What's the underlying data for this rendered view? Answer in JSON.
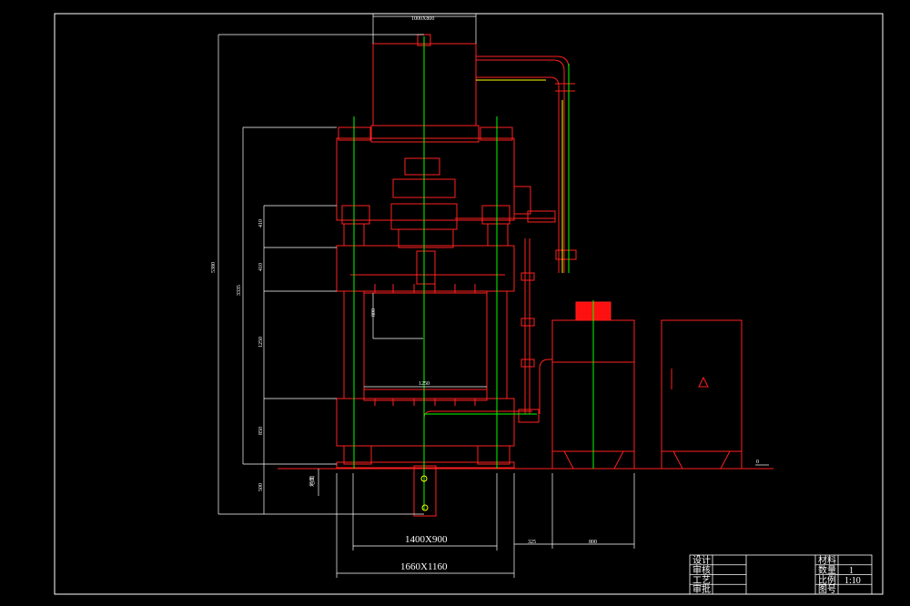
{
  "dimensions": {
    "top_width": "1000X800",
    "inner_bed": "1400X900",
    "outer_bed": "1660X1160",
    "gap": "325",
    "tank_width": "800",
    "total_height": "5380",
    "frame_height": "3335",
    "seg1": "410",
    "seg2": "410",
    "seg3": "1250",
    "seg4": "850",
    "below_floor": "500",
    "daylight": "800",
    "table_width": "1250",
    "floor_label": "地面",
    "floor_level": "0"
  },
  "title_block": {
    "left_labels": [
      "设计",
      "审核",
      "工艺",
      "审批"
    ],
    "right_labels": [
      "材料",
      "数量",
      "比例",
      "图号"
    ],
    "quantity": "1",
    "scale": "1:10"
  },
  "colors": {
    "frame": "#ff0000",
    "centerline": "#00ff00",
    "dimension": "#ffffff",
    "pipe_accent": "#ffff00"
  }
}
